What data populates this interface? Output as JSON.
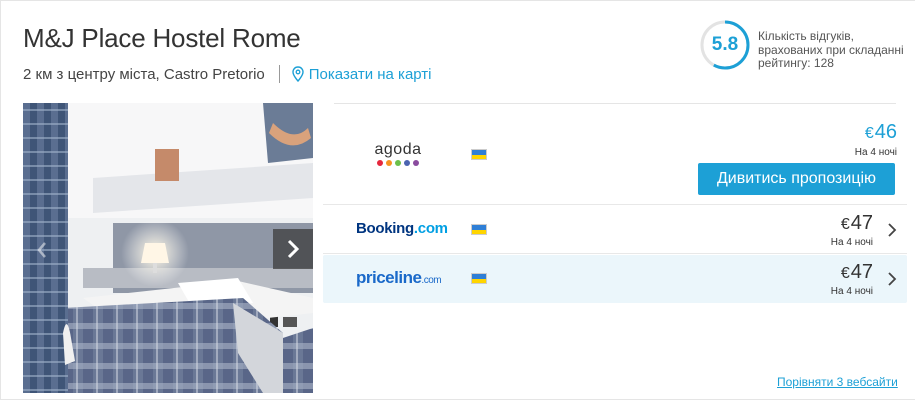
{
  "hotel": {
    "name": "M&J Place Hostel Rome",
    "distance": "2 км з центру міста, Castro Pretorio",
    "map_link": "Показати на карті"
  },
  "rating": {
    "score": "5.8",
    "score_value": 5.8,
    "description": "Кількість відгуків, врахованих при складанні рейтингу: 128"
  },
  "offers": [
    {
      "provider": "agoda",
      "currency": "€",
      "price": "46",
      "nights": "На 4 ночі",
      "button": "Дивитись пропозицію"
    },
    {
      "provider": "Booking.com",
      "provider_main": "Booking",
      "provider_tld": ".com",
      "currency": "€",
      "price": "47",
      "nights": "На 4 ночі"
    },
    {
      "provider": "priceline.com",
      "provider_main": "priceline",
      "provider_tld": ".com",
      "currency": "€",
      "price": "47",
      "nights": "На 4 ночі"
    }
  ],
  "compare_link": "Порівняти 3 вебсайти",
  "colors": {
    "accent": "#1da0d6",
    "booking": "#003580",
    "priceline": "#1a69c9",
    "highlight_row": "#ebf6fb",
    "agoda_dots": [
      "#e6273d",
      "#f79420",
      "#fbc70a",
      "#6cc04a",
      "#4b64b0",
      "#8a4b9e"
    ]
  },
  "icons": {
    "map": "map-pin-icon",
    "next": "chevron-right-icon",
    "prev": "chevron-left-icon",
    "flag": "ukraine-flag-icon"
  }
}
